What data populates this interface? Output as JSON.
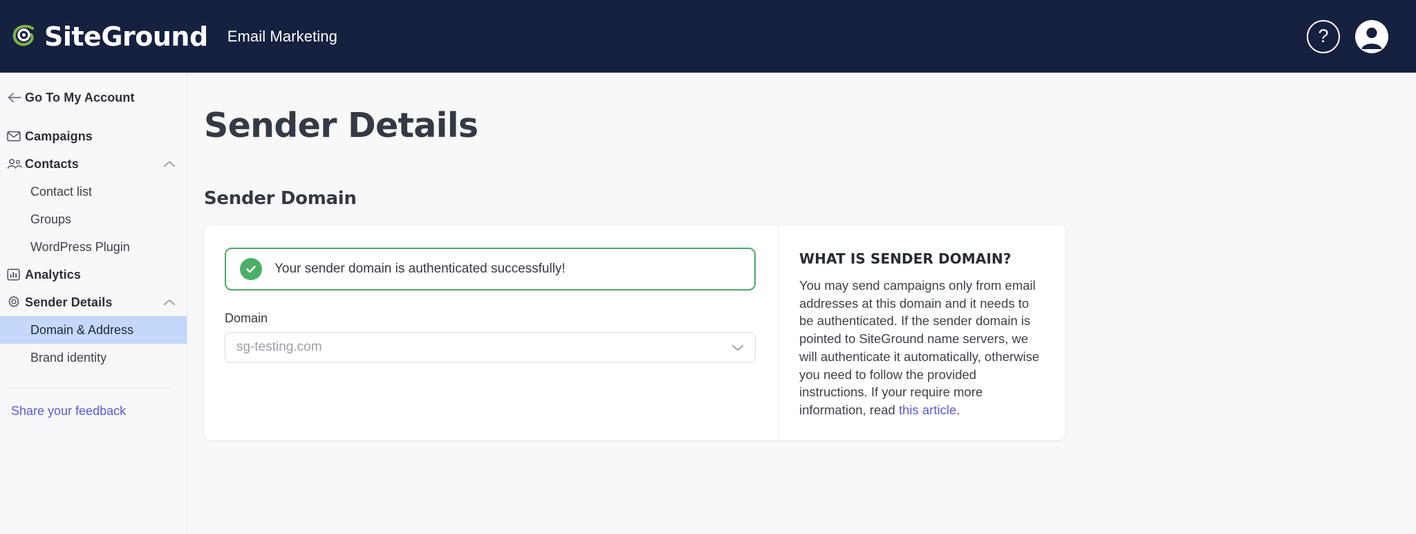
{
  "topbar": {
    "brand_name": "SiteGround",
    "app_title": "Email Marketing",
    "help_glyph": "?",
    "help_name": "help-icon",
    "avatar_name": "user-avatar"
  },
  "sidebar": {
    "back_label": "Go To My Account",
    "items": [
      {
        "label": "Campaigns",
        "icon": "envelope-icon",
        "expandable": false
      },
      {
        "label": "Contacts",
        "icon": "people-icon",
        "expandable": true
      },
      {
        "label": "Analytics",
        "icon": "chart-icon",
        "expandable": false
      },
      {
        "label": "Sender Details",
        "icon": "gear-icon",
        "expandable": true
      }
    ],
    "contacts_children": [
      "Contact list",
      "Groups",
      "WordPress Plugin"
    ],
    "sender_children": [
      "Domain & Address",
      "Brand identity"
    ],
    "active_child": "Domain & Address",
    "feedback_label": "Share your feedback"
  },
  "main": {
    "page_title": "Sender Details",
    "section_title": "Sender Domain",
    "alert": {
      "message": "Your sender domain is authenticated successfully!",
      "type": "success",
      "icon": "check-circle-icon",
      "border_color": "#53a567",
      "icon_color": "#4caf68"
    },
    "domain_field": {
      "label": "Domain",
      "value": "sg-testing.com",
      "placeholder": "sg-testing.com"
    },
    "info_panel": {
      "title": "WHAT IS SENDER DOMAIN?",
      "body_before_link": "You may send campaigns only from email addresses at this domain and it needs to be authenticated. If the sender domain is pointed to SiteGround name servers, we will authenticate it automatically, otherwise you need to follow the provided instructions. If your require more information, read ",
      "link_text": "this article",
      "body_after_link": "."
    }
  },
  "colors": {
    "topbar_bg": "#16203f",
    "sidebar_bg": "#f7f8f9",
    "active_item_bg": "#c3d8fa",
    "link": "#5a5ad6",
    "success": "#4caf68",
    "brand_green": "#7ab04a"
  }
}
